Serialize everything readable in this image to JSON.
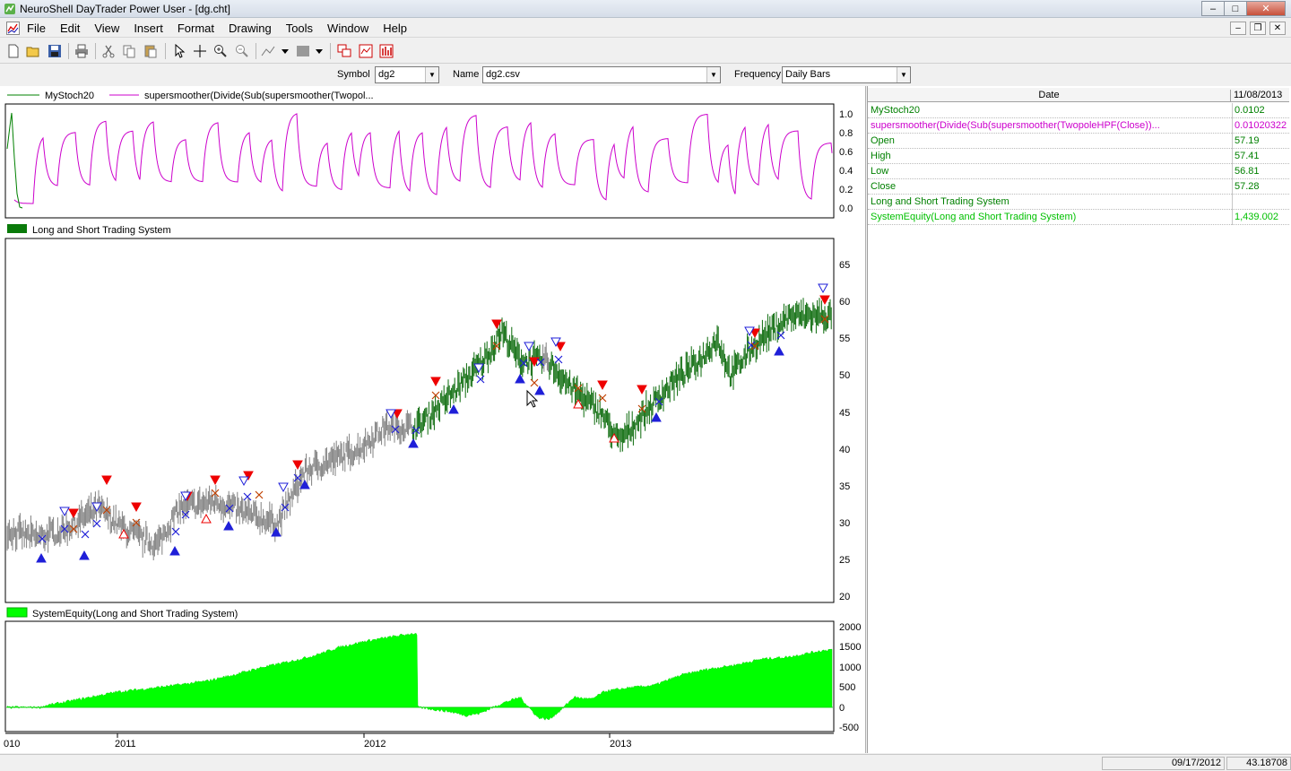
{
  "window": {
    "title": "NeuroShell DayTrader Power User - [dg.cht]",
    "minimize": "–",
    "maximize": "□",
    "close": "✕"
  },
  "menu": [
    "File",
    "Edit",
    "View",
    "Insert",
    "Format",
    "Drawing",
    "Tools",
    "Window",
    "Help"
  ],
  "mdi_buttons": [
    "–",
    "❐",
    "✕"
  ],
  "toolbar_icons": [
    "new-icon",
    "open-icon",
    "save-icon",
    "print-icon",
    "cut-icon",
    "copy-icon",
    "paste-icon",
    "pointer-icon",
    "crosshair-icon",
    "zoom-in-icon",
    "zoom-out-icon",
    "line-tool-icon",
    "fill-pattern-icon",
    "window-cascade-icon",
    "chart-window-icon",
    "bar-chart-icon"
  ],
  "selectors": {
    "symbol_label": "Symbol",
    "symbol_value": "dg2",
    "name_label": "Name",
    "name_value": "dg2.csv",
    "frequency_label": "Frequency",
    "frequency_value": "Daily Bars"
  },
  "panes": {
    "top": {
      "legend1": "MyStoch20",
      "legend2": "supersmoother(Divide(Sub(supersmoother(Twopol...",
      "y_ticks": [
        "1.0",
        "0.8",
        "0.6",
        "0.4",
        "0.2",
        "0.0"
      ]
    },
    "middle": {
      "legend": "Long and Short Trading System",
      "y_ticks": [
        "65",
        "60",
        "55",
        "50",
        "45",
        "40",
        "35",
        "30",
        "25",
        "20"
      ]
    },
    "bottom": {
      "legend": "SystemEquity(Long and Short Trading System)",
      "y_ticks": [
        "2000",
        "1500",
        "1000",
        "500",
        "0",
        "-500"
      ]
    }
  },
  "x_axis_labels": [
    "010",
    "2011",
    "2012",
    "2013"
  ],
  "data_window": {
    "date_header": "Date",
    "date_value": "11/08/2013",
    "rows": [
      {
        "name": "MyStoch20",
        "value": "0.0102",
        "color": "#008000"
      },
      {
        "name": "supersmoother(Divide(Sub(supersmoother(TwopoleHPF(Close))...",
        "value": "0.01020322",
        "color": "#cc00cc"
      },
      {
        "name": "Open",
        "value": "57.19",
        "color": "#008000"
      },
      {
        "name": "High",
        "value": "57.41",
        "color": "#008000"
      },
      {
        "name": "Low",
        "value": "56.81",
        "color": "#008000"
      },
      {
        "name": "Close",
        "value": "57.28",
        "color": "#008000"
      },
      {
        "name": "Long and Short Trading System",
        "value": "",
        "color": "#008000"
      },
      {
        "name": "SystemEquity(Long and Short Trading System)",
        "value": "1,439.002",
        "color": "#00c000"
      }
    ]
  },
  "status": {
    "date": "09/17/2012",
    "value": "43.18708"
  },
  "colors": {
    "oscillator": "#cc00cc",
    "stoch": "#008000",
    "price_green": "#006400",
    "price_gray": "#777777",
    "equity": "#00ff00",
    "buy_marker": "#1f1fd8",
    "sell_marker": "#ee0000"
  }
}
